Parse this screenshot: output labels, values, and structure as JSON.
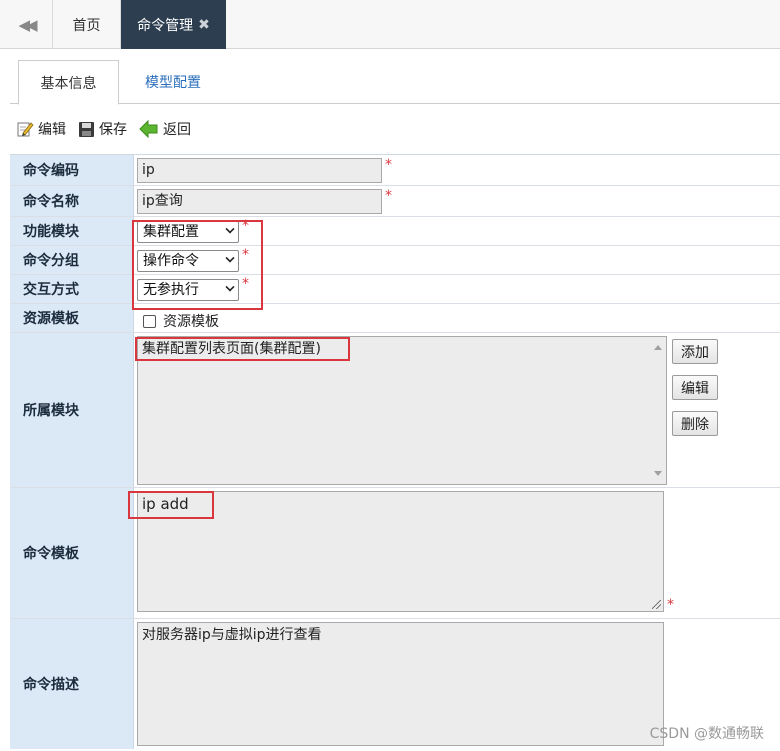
{
  "top_tabs": {
    "back_icon": "double-chevron-left-icon",
    "home": "首页",
    "active": "命令管理",
    "close_icon": "close-icon"
  },
  "sub_tabs": {
    "basic": "基本信息",
    "model": "模型配置"
  },
  "toolbar": {
    "edit": "编辑",
    "save": "保存",
    "back": "返回"
  },
  "form": {
    "code": {
      "label": "命令编码",
      "value": "ip"
    },
    "name": {
      "label": "命令名称",
      "value": "ip查询"
    },
    "module": {
      "label": "功能模块",
      "value": "集群配置"
    },
    "group": {
      "label": "命令分组",
      "value": "操作命令"
    },
    "interaction": {
      "label": "交互方式",
      "value": "无参执行"
    },
    "resource": {
      "label": "资源模板",
      "checkbox_label": "资源模板",
      "checked": false
    },
    "belong": {
      "label": "所属模块",
      "value": "集群配置列表页面(集群配置)",
      "buttons": {
        "add": "添加",
        "edit": "编辑",
        "delete": "删除"
      }
    },
    "template": {
      "label": "命令模板",
      "value": "ip add"
    },
    "desc": {
      "label": "命令描述",
      "value": "对服务器ip与虚拟ip进行查看"
    },
    "required_mark": "*"
  },
  "watermark": "CSDN @数通畅联",
  "colors": {
    "label_bg": "#dbe9f7",
    "active_tab": "#2c3e50",
    "highlight": "#d9363e",
    "link": "#2a6ebb"
  }
}
